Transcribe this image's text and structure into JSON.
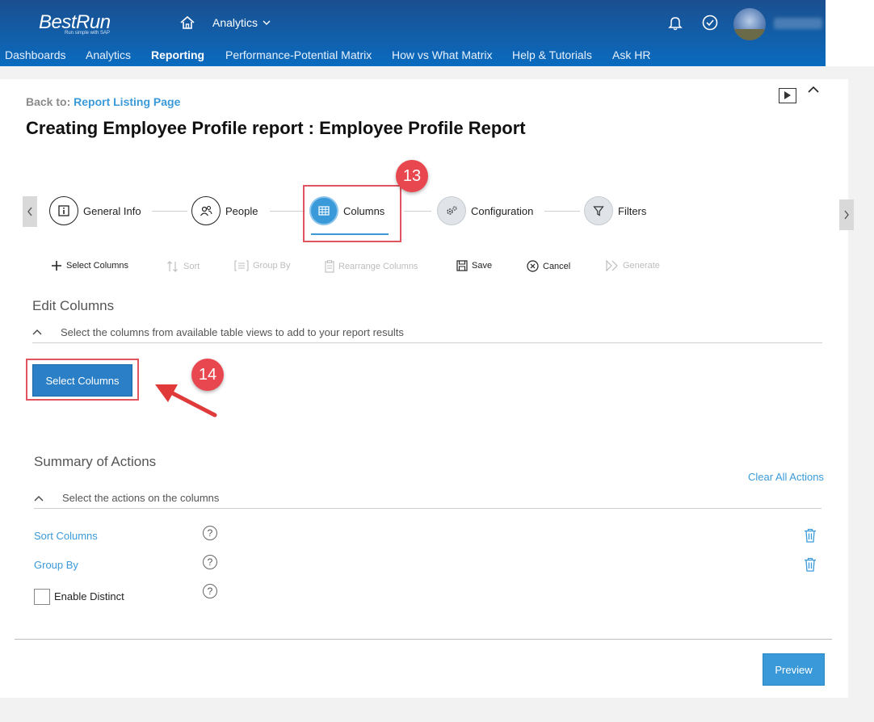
{
  "header": {
    "logo_text": "BestRun",
    "logo_tagline": "Run simple with SAP",
    "module_menu": "Analytics",
    "nav": [
      "Dashboards",
      "Analytics",
      "Reporting",
      "Performance-Potential Matrix",
      "How vs What Matrix",
      "Help & Tutorials",
      "Ask HR"
    ],
    "active_nav": "Reporting"
  },
  "page": {
    "back_prefix": "Back to:",
    "back_link": "Report Listing Page",
    "title": "Creating Employee Profile report : Employee Profile Report"
  },
  "wizard": {
    "steps": [
      "General Info",
      "People",
      "Columns",
      "Configuration",
      "Filters"
    ],
    "active_step": "Columns"
  },
  "annotations": {
    "badge_13": "13",
    "badge_14": "14",
    "highlight_color": "#e05560"
  },
  "toolbar": {
    "select_columns": "Select Columns",
    "sort": "Sort",
    "group_by": "Group By",
    "rearrange": "Rearrange Columns",
    "save": "Save",
    "cancel": "Cancel",
    "generate": "Generate"
  },
  "edit_columns": {
    "title": "Edit Columns",
    "subtitle": "Select the columns from available table views to add to your report results",
    "button": "Select Columns"
  },
  "summary": {
    "title": "Summary of Actions",
    "clear_all": "Clear All Actions",
    "subtitle": "Select the actions on the columns",
    "sort_columns": "Sort Columns",
    "group_by": "Group By",
    "enable_distinct": "Enable Distinct",
    "help_glyph": "?"
  },
  "footer": {
    "preview": "Preview"
  },
  "colors": {
    "brand_blue": "#0a6bbf",
    "accent": "#3a9ad9",
    "badge_red": "#e8474f"
  }
}
